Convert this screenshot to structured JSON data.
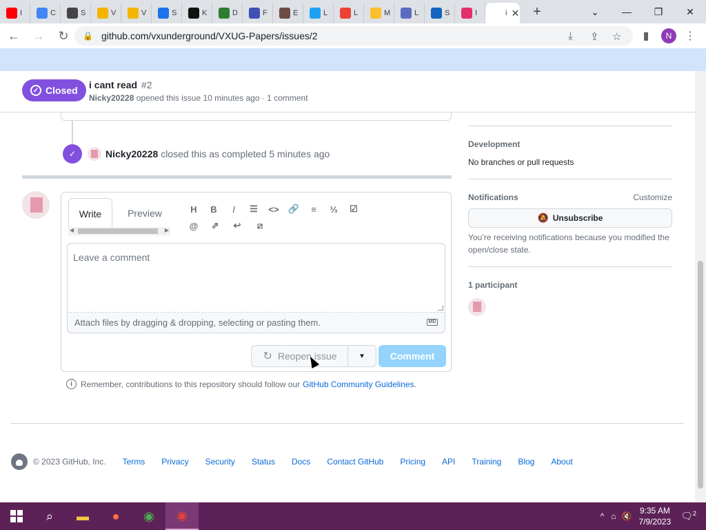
{
  "browser": {
    "tabs": [
      {
        "label": "I",
        "favicon": "youtube-icon",
        "color": "#ff0000"
      },
      {
        "label": "C",
        "favicon": "google-icon",
        "color": "#4285f4"
      },
      {
        "label": "S",
        "favicon": "gear-icon",
        "color": "#444444"
      },
      {
        "label": "V",
        "favicon": "slides-icon",
        "color": "#f4b400"
      },
      {
        "label": "V",
        "favicon": "slides-icon",
        "color": "#f4b400"
      },
      {
        "label": "S",
        "favicon": "image-icon",
        "color": "#1a73e8"
      },
      {
        "label": "K",
        "favicon": "kim-icon",
        "color": "#111111"
      },
      {
        "label": "D",
        "favicon": "grid-icon",
        "color": "#2e7d32"
      },
      {
        "label": "F",
        "favicon": "photo-icon",
        "color": "#3f51b5"
      },
      {
        "label": "E",
        "favicon": "circle-icon",
        "color": "#6d4c41"
      },
      {
        "label": "L",
        "favicon": "twitter-icon",
        "color": "#1da1f2"
      },
      {
        "label": "L",
        "favicon": "gmail-icon",
        "color": "#ea4335"
      },
      {
        "label": "M",
        "favicon": "bulb-icon",
        "color": "#fbc02d"
      },
      {
        "label": "L",
        "favicon": "photo-icon",
        "color": "#5c6bc0"
      },
      {
        "label": "S",
        "favicon": "sonic-icon",
        "color": "#1565c0"
      },
      {
        "label": "I",
        "favicon": "instagram-icon",
        "color": "#e1306c"
      },
      {
        "label": "i",
        "favicon": "github-icon",
        "color": "#ffffff",
        "active": true
      }
    ],
    "url": "github.com/vxunderground/VXUG-Papers/issues/2",
    "profile_initial": "N"
  },
  "issue": {
    "state": "Closed",
    "title": "i cant read",
    "number": "#2",
    "author": "Nicky20228",
    "meta": "opened this issue 10 minutes ago · 1 comment"
  },
  "timeline": {
    "closed_actor": "Nicky20228",
    "closed_text": "closed this as completed 5 minutes ago"
  },
  "editor": {
    "tab_write": "Write",
    "tab_preview": "Preview",
    "placeholder": "Leave a comment",
    "attach_text": "Attach files by dragging & dropping, selecting or pasting them.",
    "md_badge": "MD",
    "reopen_label": "Reopen issue",
    "comment_label": "Comment"
  },
  "guidelines": {
    "text": "Remember, contributions to this repository should follow our",
    "link": "GitHub Community Guidelines",
    "suffix": "."
  },
  "sidebar": {
    "development_heading": "Development",
    "development_text": "No branches or pull requests",
    "notifications_heading": "Notifications",
    "customize": "Customize",
    "unsubscribe": "Unsubscribe",
    "notification_reason": "You’re receiving notifications because you modified the open/close state.",
    "participants_heading": "1 participant"
  },
  "footer": {
    "copyright": "© 2023 GitHub, Inc.",
    "links": [
      "Terms",
      "Privacy",
      "Security",
      "Status",
      "Docs",
      "Contact GitHub",
      "Pricing",
      "API",
      "Training",
      "Blog",
      "About"
    ]
  },
  "taskbar": {
    "time": "9:35 AM",
    "date": "7/9/2023",
    "notification_count": "2"
  },
  "colors": {
    "closed_purple": "#8250df",
    "link_blue": "#0969da",
    "taskbar": "#5c2257"
  }
}
